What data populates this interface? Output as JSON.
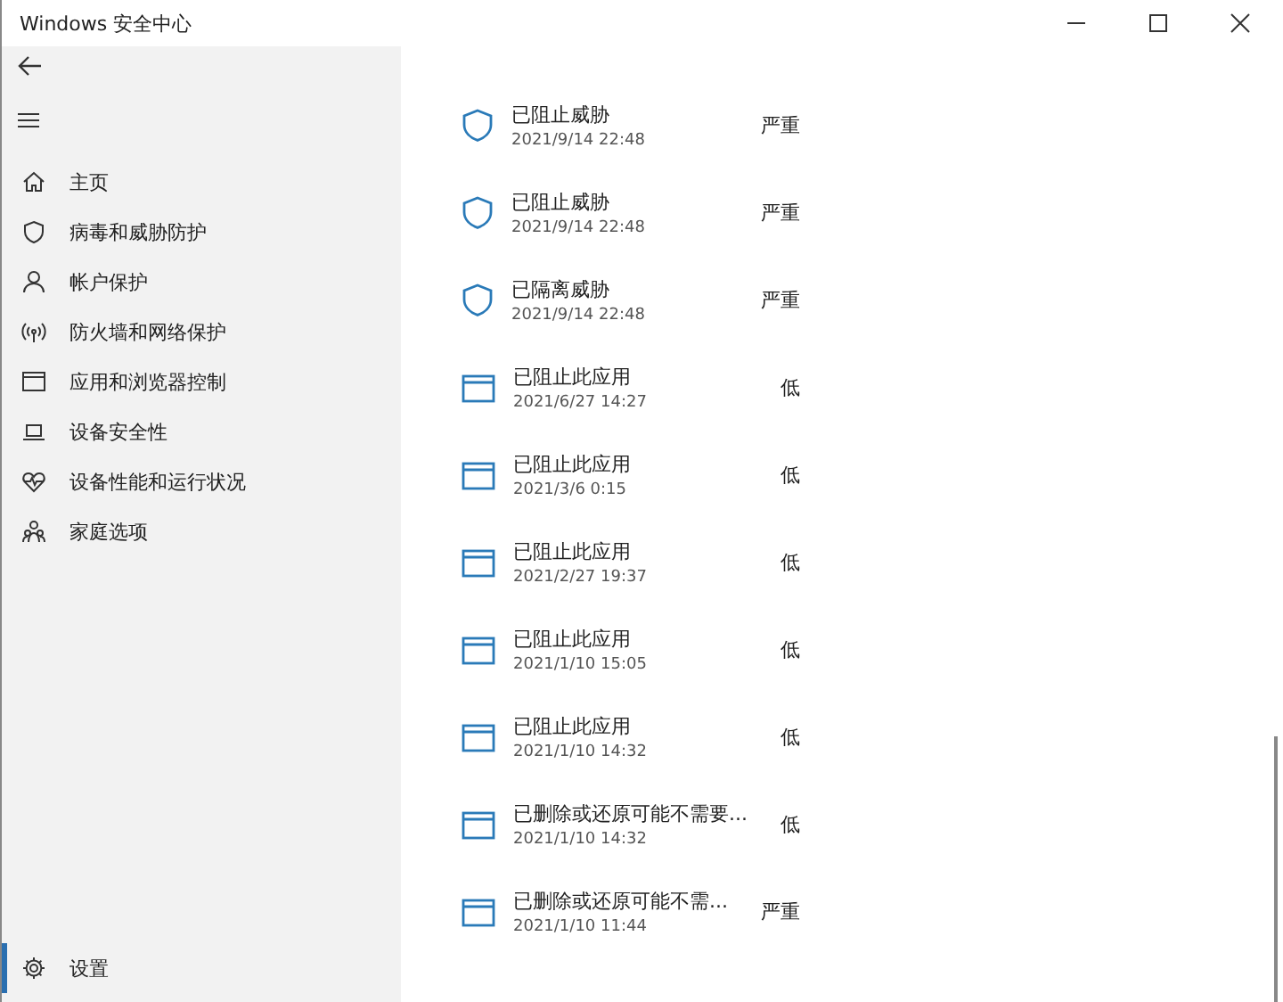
{
  "window": {
    "title": "Windows 安全中心"
  },
  "sidebar": {
    "items": [
      {
        "label": "主页",
        "kind": "home",
        "selected": false
      },
      {
        "label": "病毒和威胁防护",
        "kind": "virus",
        "selected": false
      },
      {
        "label": "帐户保护",
        "kind": "account",
        "selected": false
      },
      {
        "label": "防火墙和网络保护",
        "kind": "network",
        "selected": false
      },
      {
        "label": "应用和浏览器控制",
        "kind": "app",
        "selected": false
      },
      {
        "label": "设备安全性",
        "kind": "device",
        "selected": false
      },
      {
        "label": "设备性能和运行状况",
        "kind": "health",
        "selected": false
      },
      {
        "label": "家庭选项",
        "kind": "family",
        "selected": false
      }
    ],
    "settings": {
      "label": "设置",
      "selected": true
    }
  },
  "history": [
    {
      "kind": "shield",
      "title": "已阻止威胁",
      "date": "2021/9/14 22:48",
      "severity": "严重"
    },
    {
      "kind": "shield",
      "title": "已阻止威胁",
      "date": "2021/9/14 22:48",
      "severity": "严重"
    },
    {
      "kind": "shield",
      "title": "已隔离威胁",
      "date": "2021/9/14 22:48",
      "severity": "严重"
    },
    {
      "kind": "app",
      "title": "已阻止此应用",
      "date": "2021/6/27 14:27",
      "severity": "低"
    },
    {
      "kind": "app",
      "title": "已阻止此应用",
      "date": "2021/3/6 0:15",
      "severity": "低"
    },
    {
      "kind": "app",
      "title": "已阻止此应用",
      "date": "2021/2/27 19:37",
      "severity": "低"
    },
    {
      "kind": "app",
      "title": "已阻止此应用",
      "date": "2021/1/10 15:05",
      "severity": "低"
    },
    {
      "kind": "app",
      "title": "已阻止此应用",
      "date": "2021/1/10 14:32",
      "severity": "低"
    },
    {
      "kind": "app",
      "title": "已删除或还原可能不需要...",
      "date": "2021/1/10 14:32",
      "severity": "低"
    },
    {
      "kind": "app",
      "title": "已删除或还原可能不需...",
      "date": "2021/1/10 11:44",
      "severity": "严重"
    }
  ]
}
